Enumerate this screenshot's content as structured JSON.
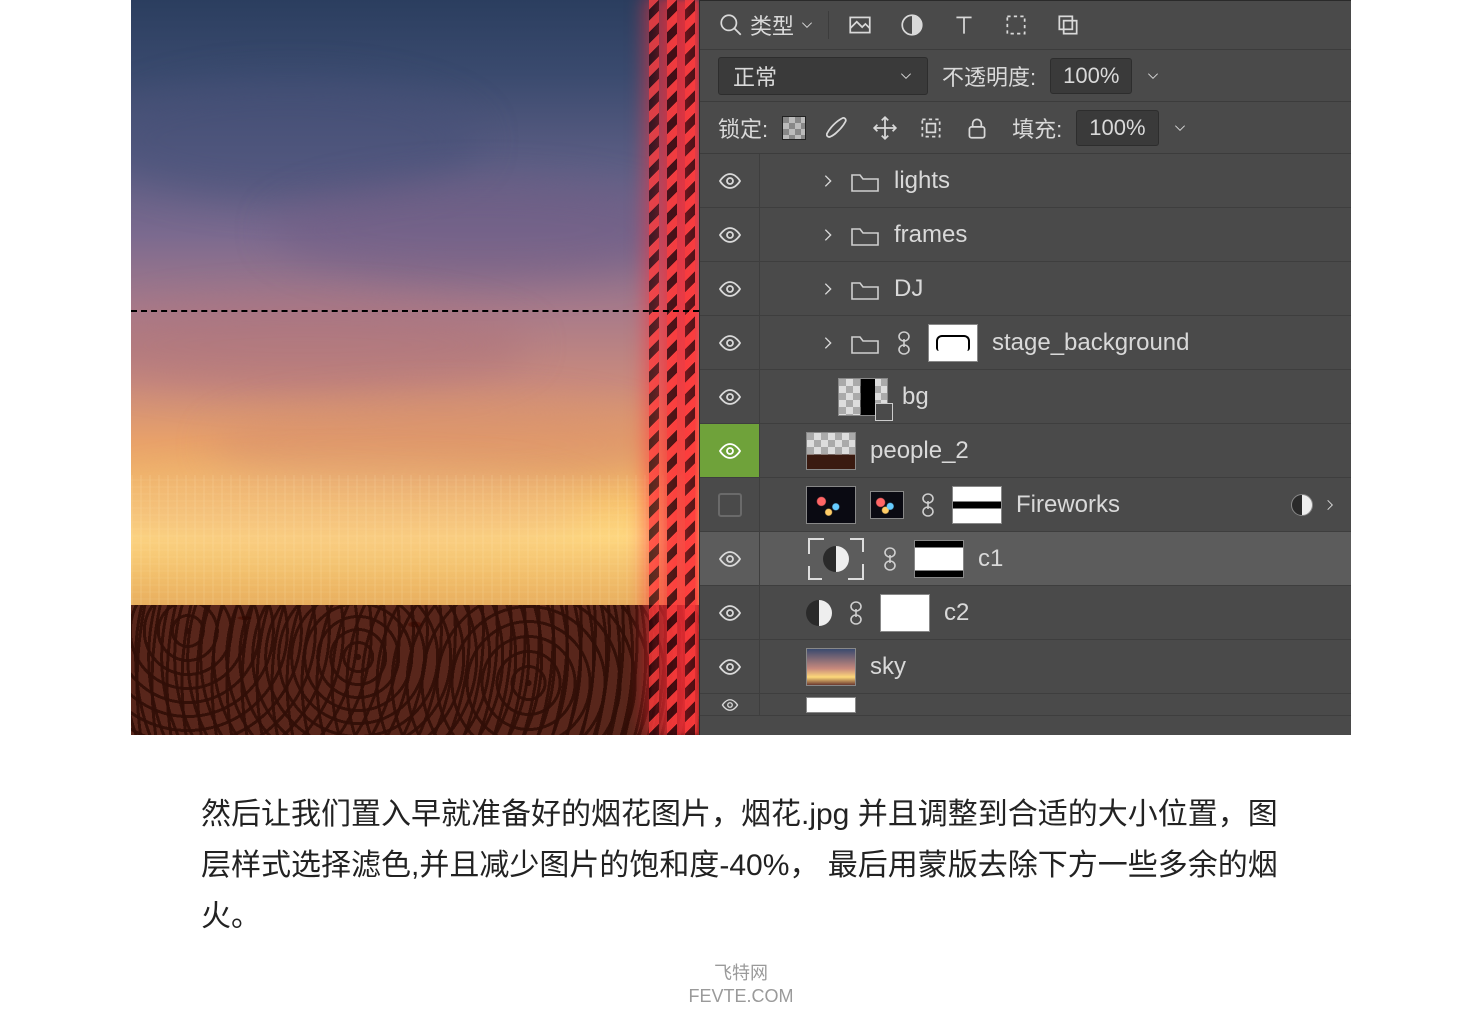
{
  "panel": {
    "search_label": "类型",
    "blend_mode": "正常",
    "opacity_label": "不透明度:",
    "opacity_value": "100%",
    "lock_label": "锁定:",
    "fill_label": "填充:",
    "fill_value": "100%"
  },
  "layers": {
    "lights": "lights",
    "frames": "frames",
    "dj": "DJ",
    "stage_bg": "stage_background",
    "bg": "bg",
    "people2": "people_2",
    "fireworks": "Fireworks",
    "c1": "c1",
    "c2": "c2",
    "sky": "sky"
  },
  "caption": {
    "line1": "然后让我们置入早就准备好的烟花图片，烟花.jpg 并且调整到合适的大小位置，图层样式选择滤色,并且减少图片的饱和度-40%， 最后用蒙版去除下方一些多余的烟火。"
  },
  "watermark": {
    "l1": "飞特网",
    "l2": "FEVTE.COM"
  }
}
